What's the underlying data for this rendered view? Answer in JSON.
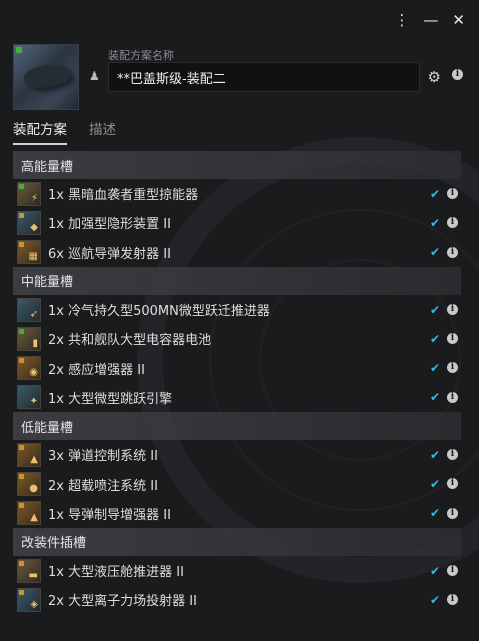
{
  "header": {
    "fitting_name_label": "装配方案名称",
    "fitting_name_value": "**巴盖斯级-装配二"
  },
  "tabs": [
    {
      "label": "装配方案"
    },
    {
      "label": "描述"
    }
  ],
  "sections": [
    {
      "title": "高能量槽",
      "items": [
        {
          "text": "1x 黑暗血袭者重型掠能器"
        },
        {
          "text": "1x 加强型隐形装置 II"
        },
        {
          "text": "6x 巡航导弹发射器 II"
        }
      ]
    },
    {
      "title": "中能量槽",
      "items": [
        {
          "text": "1x 冷气持久型500MN微型跃迁推进器"
        },
        {
          "text": "2x 共和舰队大型电容器电池"
        },
        {
          "text": "2x 感应增强器 II"
        },
        {
          "text": "1x 大型微型跳跃引擎"
        }
      ]
    },
    {
      "title": "低能量槽",
      "items": [
        {
          "text": "3x 弹道控制系统 II"
        },
        {
          "text": "2x 超载喷注系统 II"
        },
        {
          "text": "1x 导弹制导增强器 II"
        }
      ]
    },
    {
      "title": "改装件插槽",
      "items": [
        {
          "text": "1x 大型液压舱推进器 II"
        },
        {
          "text": "2x 大型离子力场投射器 II"
        }
      ]
    }
  ],
  "colors": {
    "background": "#1a1b1d",
    "check": "#35b8e8",
    "section_bg": "#404246"
  },
  "icons": {
    "menu": "more-vertical-icon",
    "minimize": "minimize-icon",
    "close": "close-icon",
    "settings": "gear-icon",
    "info": "info-icon",
    "check": "check-icon",
    "person": "person-icon"
  }
}
